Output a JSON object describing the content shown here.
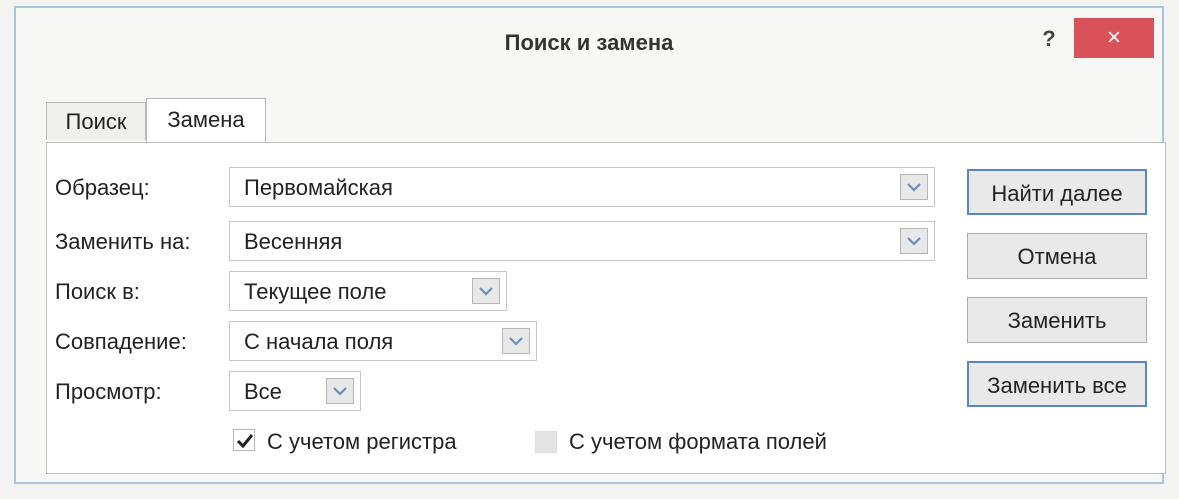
{
  "window": {
    "title": "Поиск и замена",
    "help": "?",
    "close": "×"
  },
  "tabs": [
    "Поиск",
    "Замена"
  ],
  "form": {
    "pattern": {
      "label": "Образец:",
      "value": "Первомайская"
    },
    "replace": {
      "label": "Заменить на:",
      "value": "Весенняя"
    },
    "search_in": {
      "label": "Поиск в:",
      "value": "Текущее поле"
    },
    "match": {
      "label": "Совпадение:",
      "value": "С начала поля"
    },
    "view": {
      "label": "Просмотр:",
      "value": "Все"
    }
  },
  "options": {
    "case": {
      "label": "С учетом регистра",
      "checked": true
    },
    "format": {
      "label": "С учетом формата полей",
      "checked": false
    }
  },
  "buttons": {
    "find_next": "Найти далее",
    "cancel": "Отмена",
    "replace": "Заменить",
    "replace_all": "Заменить все"
  }
}
